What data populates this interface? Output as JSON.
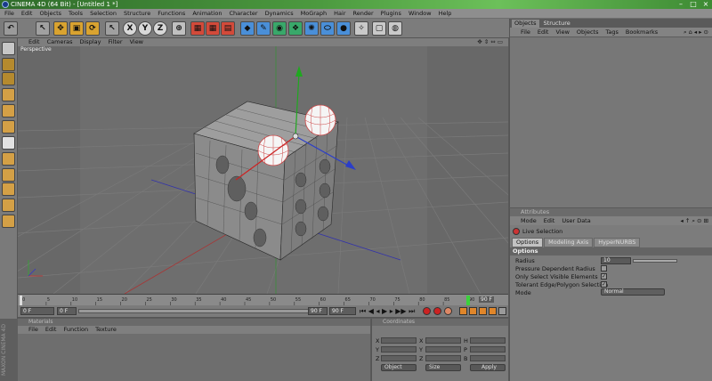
{
  "window": {
    "title": "CINEMA 4D (64 Bit) - [Untitled 1 *]",
    "minimize": "–",
    "maximize": "□",
    "close": "×"
  },
  "menubar": [
    "File",
    "Edit",
    "Objects",
    "Tools",
    "Selection",
    "Structure",
    "Functions",
    "Animation",
    "Character",
    "Dynamics",
    "MoGraph",
    "Hair",
    "Render",
    "Plugins",
    "Window",
    "Help"
  ],
  "toolbar": {
    "x_label": "X",
    "y_label": "Y",
    "z_label": "Z"
  },
  "viewport": {
    "menu": [
      "Edit",
      "Cameras",
      "Display",
      "Filter",
      "View"
    ],
    "label": "Perspective"
  },
  "timeline": {
    "ticks": [
      "0",
      "5",
      "10",
      "15",
      "20",
      "25",
      "30",
      "35",
      "40",
      "45",
      "50",
      "55",
      "60",
      "65",
      "70",
      "75",
      "80",
      "85",
      "90"
    ],
    "end_frame": "90 F",
    "current_frame": "0 F",
    "start_field": "0 F",
    "end_field": "90 F",
    "range_end": "90 F"
  },
  "materials": {
    "title": "Materials",
    "menu": [
      "File",
      "Edit",
      "Function",
      "Texture"
    ]
  },
  "coordinates": {
    "title": "Coordinates",
    "labels": [
      "X",
      "Y",
      "Z"
    ],
    "right_labels": [
      "H",
      "P",
      "B"
    ],
    "object_dropdown": "Object",
    "size_dropdown": "Size",
    "apply_button": "Apply"
  },
  "brand": "MAXON CINEMA 4D",
  "objects_panel": {
    "tabs": [
      "Objects",
      "Structure"
    ],
    "menu": [
      "File",
      "Edit",
      "View",
      "Objects",
      "Tags",
      "Bookmarks"
    ]
  },
  "attributes_panel": {
    "title": "Attributes",
    "menu": [
      "Mode",
      "Edit",
      "User Data"
    ],
    "tool_name": "Live Selection",
    "subtabs": [
      "Options",
      "Modeling Axis",
      "HyperNURBS"
    ],
    "section": "Options",
    "radius_label": "Radius",
    "radius_value": "10",
    "pressure_label": "Pressure Dependent Radius",
    "visible_label": "Only Select Visible Elements",
    "tolerant_label": "Tolerant Edge/Polygon Selection",
    "mode_label": "Mode",
    "mode_value": "Normal"
  }
}
